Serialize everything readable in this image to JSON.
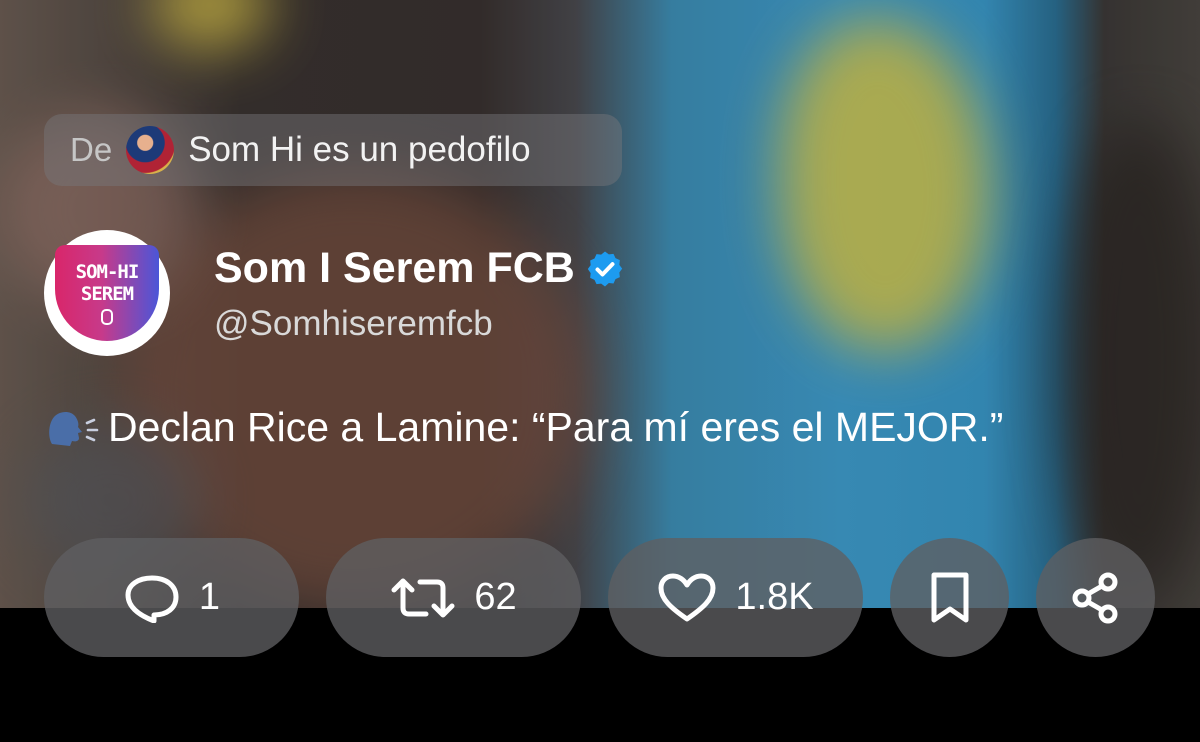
{
  "source": {
    "prefix": "De",
    "name": "Som Hi es un pedofilo"
  },
  "author": {
    "avatar_text_line1": "SOM-HI",
    "avatar_text_line2": "SEREM",
    "display_name": "Som I Serem FCB",
    "verified": true,
    "handle": "@Somhiseremfcb"
  },
  "post": {
    "emoji": "speaking-head",
    "text": "Declan Rice a Lamine: “Para mí eres el MEJOR.”"
  },
  "actions": {
    "replies": "1",
    "reposts": "62",
    "likes": "1.8K"
  },
  "colors": {
    "verified_badge": "#1d9bf0",
    "pill_background": "#5f5f62"
  }
}
